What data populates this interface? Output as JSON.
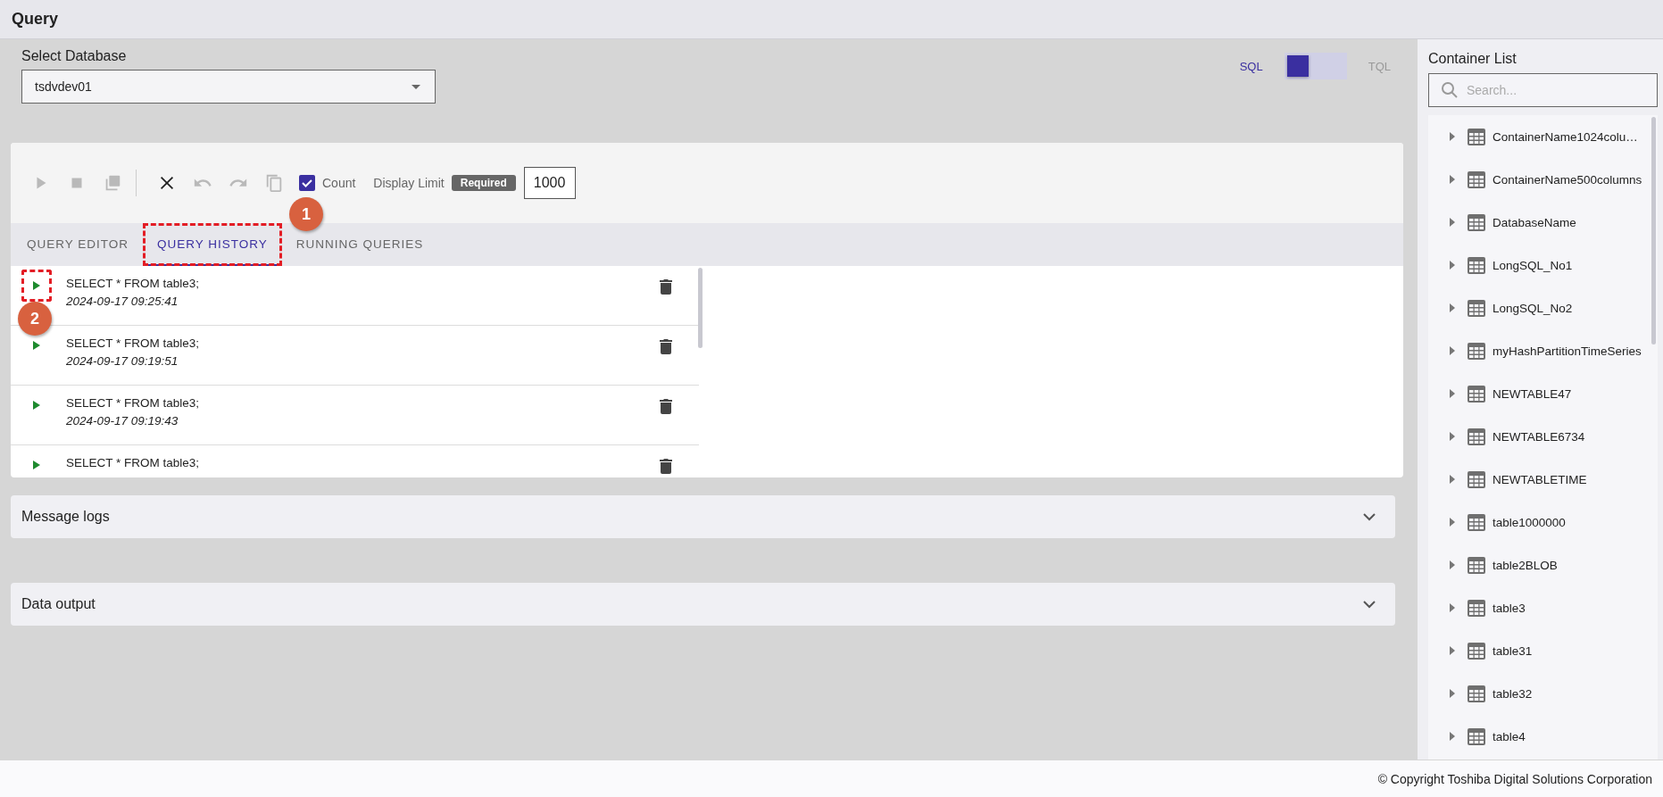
{
  "header": {
    "title": "Query"
  },
  "database": {
    "label": "Select Database",
    "value": "tsdvdev01"
  },
  "mode_toggle": {
    "options": [
      {
        "label": "SQL",
        "selected": true
      },
      {
        "label": "TQL",
        "selected": false
      }
    ]
  },
  "toolbar": {
    "buttons": [
      {
        "kind": "run",
        "disabled": true
      },
      {
        "kind": "stop",
        "disabled": true
      },
      {
        "kind": "duplicate",
        "disabled": true
      },
      {
        "kind": "divider"
      },
      {
        "kind": "clear",
        "disabled": false
      },
      {
        "kind": "undo",
        "disabled": true
      },
      {
        "kind": "redo",
        "disabled": true
      },
      {
        "kind": "copy",
        "disabled": true
      }
    ],
    "count": {
      "label": "Count",
      "checked": true
    },
    "display_limit": {
      "label": "Display Limit",
      "badge": "Required",
      "value": "1000"
    }
  },
  "tabs": [
    {
      "label": "QUERY EDITOR",
      "selected": false,
      "highlighted": false
    },
    {
      "label": "QUERY HISTORY",
      "selected": true,
      "highlighted": true
    },
    {
      "label": "RUNNING QUERIES",
      "selected": false,
      "highlighted": false
    }
  ],
  "history": [
    {
      "query": "SELECT * FROM table3;",
      "time": "2024-09-17 09:25:41",
      "highlighted": true
    },
    {
      "query": "SELECT * FROM table3;",
      "time": "2024-09-17 09:19:51",
      "highlighted": false
    },
    {
      "query": "SELECT * FROM table3;",
      "time": "2024-09-17 09:19:43",
      "highlighted": false
    },
    {
      "query": "SELECT * FROM table3;",
      "highlighted": false
    }
  ],
  "annotations": [
    {
      "label": "1"
    },
    {
      "label": "2"
    }
  ],
  "panels": [
    {
      "title": "Message logs",
      "expanded": false
    },
    {
      "title": "Data output",
      "expanded": false
    }
  ],
  "container_list": {
    "title": "Container List",
    "search_placeholder": "Search...",
    "items": [
      {
        "name": "ContainerName1024colu…",
        "expanded": false
      },
      {
        "name": "ContainerName500columns",
        "expanded": false
      },
      {
        "name": "DatabaseName",
        "expanded": false
      },
      {
        "name": "LongSQL_No1",
        "expanded": false
      },
      {
        "name": "LongSQL_No2",
        "expanded": false
      },
      {
        "name": "myHashPartitionTimeSeries",
        "expanded": false
      },
      {
        "name": "NEWTABLE47",
        "expanded": false
      },
      {
        "name": "NEWTABLE6734",
        "expanded": false
      },
      {
        "name": "NEWTABLETIME",
        "expanded": false
      },
      {
        "name": "table1000000",
        "expanded": false
      },
      {
        "name": "table2BLOB",
        "expanded": false
      },
      {
        "name": "table3",
        "expanded": false
      },
      {
        "name": "table31",
        "expanded": false
      },
      {
        "name": "table32",
        "expanded": false
      },
      {
        "name": "table4",
        "expanded": false
      }
    ]
  },
  "footer": {
    "text": "© Copyright Toshiba Digital Solutions Corporation"
  }
}
